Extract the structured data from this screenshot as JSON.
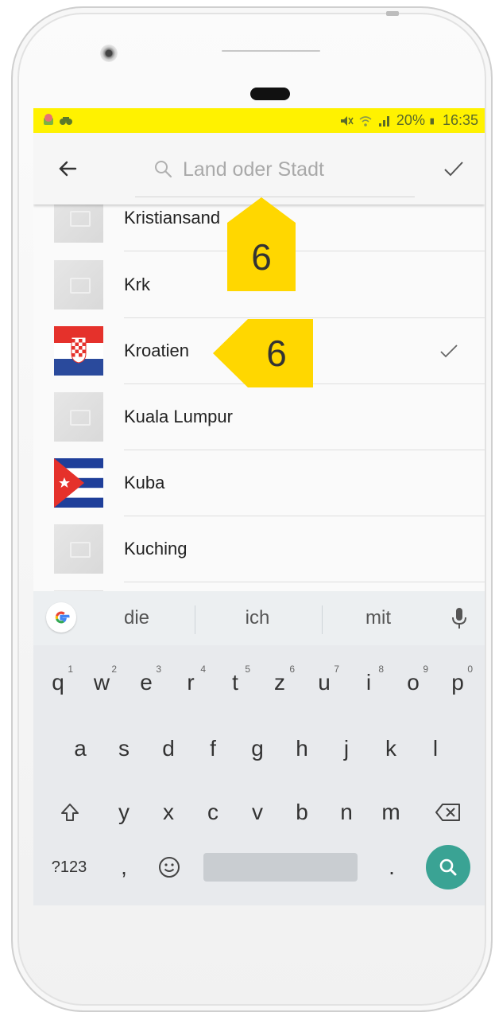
{
  "colors": {
    "statusbar": "#fff200",
    "callout": "#ffd700",
    "accent_search_key": "#3aa394"
  },
  "status": {
    "icons_left": [
      "android-robot-icon",
      "binoculars-icon"
    ],
    "battery": "20%",
    "time": "16:35",
    "icons_right": [
      "mute-icon",
      "wifi-icon",
      "signal-icon",
      "battery-icon"
    ]
  },
  "toolbar": {
    "back_icon": "arrow-left-icon",
    "search_placeholder": "Land oder Stadt",
    "search_value": "",
    "confirm_icon": "checkmark-icon"
  },
  "list": {
    "items": [
      {
        "label": "Kristiansand",
        "thumb": "placeholder",
        "selected": false
      },
      {
        "label": "Krk",
        "thumb": "placeholder",
        "selected": false
      },
      {
        "label": "Kroatien",
        "thumb": "flag-croatia",
        "selected": true
      },
      {
        "label": "Kuala Lumpur",
        "thumb": "placeholder",
        "selected": false
      },
      {
        "label": "Kuba",
        "thumb": "flag-cuba",
        "selected": false
      },
      {
        "label": "Kuching",
        "thumb": "placeholder",
        "selected": false
      }
    ]
  },
  "callouts": [
    {
      "label": "6"
    },
    {
      "label": "6"
    }
  ],
  "keyboard": {
    "suggestions": [
      "die",
      "ich",
      "mit"
    ],
    "row1": [
      {
        "k": "q",
        "n": "1"
      },
      {
        "k": "w",
        "n": "2"
      },
      {
        "k": "e",
        "n": "3"
      },
      {
        "k": "r",
        "n": "4"
      },
      {
        "k": "t",
        "n": "5"
      },
      {
        "k": "z",
        "n": "6"
      },
      {
        "k": "u",
        "n": "7"
      },
      {
        "k": "i",
        "n": "8"
      },
      {
        "k": "o",
        "n": "9"
      },
      {
        "k": "p",
        "n": "0"
      }
    ],
    "row2": [
      "a",
      "s",
      "d",
      "f",
      "g",
      "h",
      "j",
      "k",
      "l"
    ],
    "row3": [
      "y",
      "x",
      "c",
      "v",
      "b",
      "n",
      "m"
    ],
    "row4": {
      "symbols": "?123",
      "comma": ",",
      "period": "."
    },
    "icons": [
      "google-g-icon",
      "microphone-icon",
      "shift-icon",
      "backspace-icon",
      "emoji-icon",
      "search-icon"
    ]
  }
}
